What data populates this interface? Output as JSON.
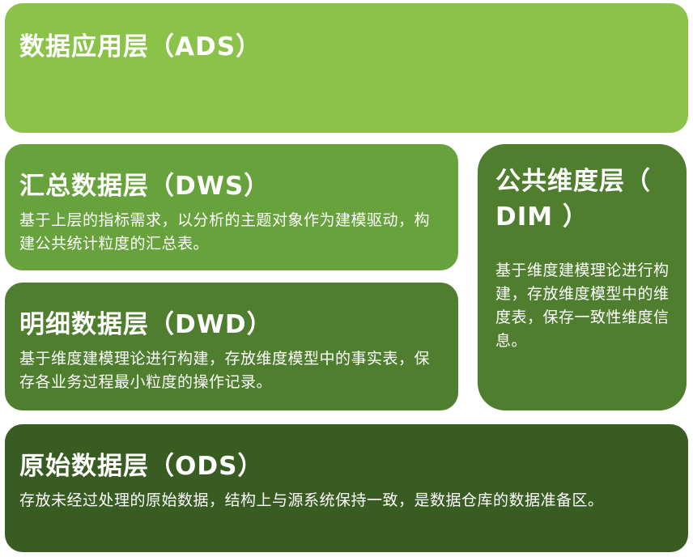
{
  "layers": {
    "ads": {
      "title": "数据应用层（ADS）",
      "color": "#8bc34a"
    },
    "dws": {
      "title": "汇总数据层（DWS）",
      "description": "基于上层的指标需求，以分析的主题对象作为建模驱动，构建公共统计粒度的汇总表。",
      "color": "#67a23c"
    },
    "dwd": {
      "title": "明细数据层（DWD）",
      "description": "基于维度建模理论进行构建，存放维度模型中的事实表，保存各业务过程最小粒度的操作记录。",
      "color": "#4f7f2e"
    },
    "dim": {
      "title": "公共维度层（ DIM ）",
      "description": "基于维度建模理论进行构建，存放维度模型中的维度表，保存一致性维度信息。",
      "color": "#4f7f2e"
    },
    "ods": {
      "title": "原始数据层（ODS）",
      "description": "存放未经过处理的原始数据，结构上与源系统保持一致，是数据仓库的数据准备区。",
      "color": "#385c22"
    }
  }
}
